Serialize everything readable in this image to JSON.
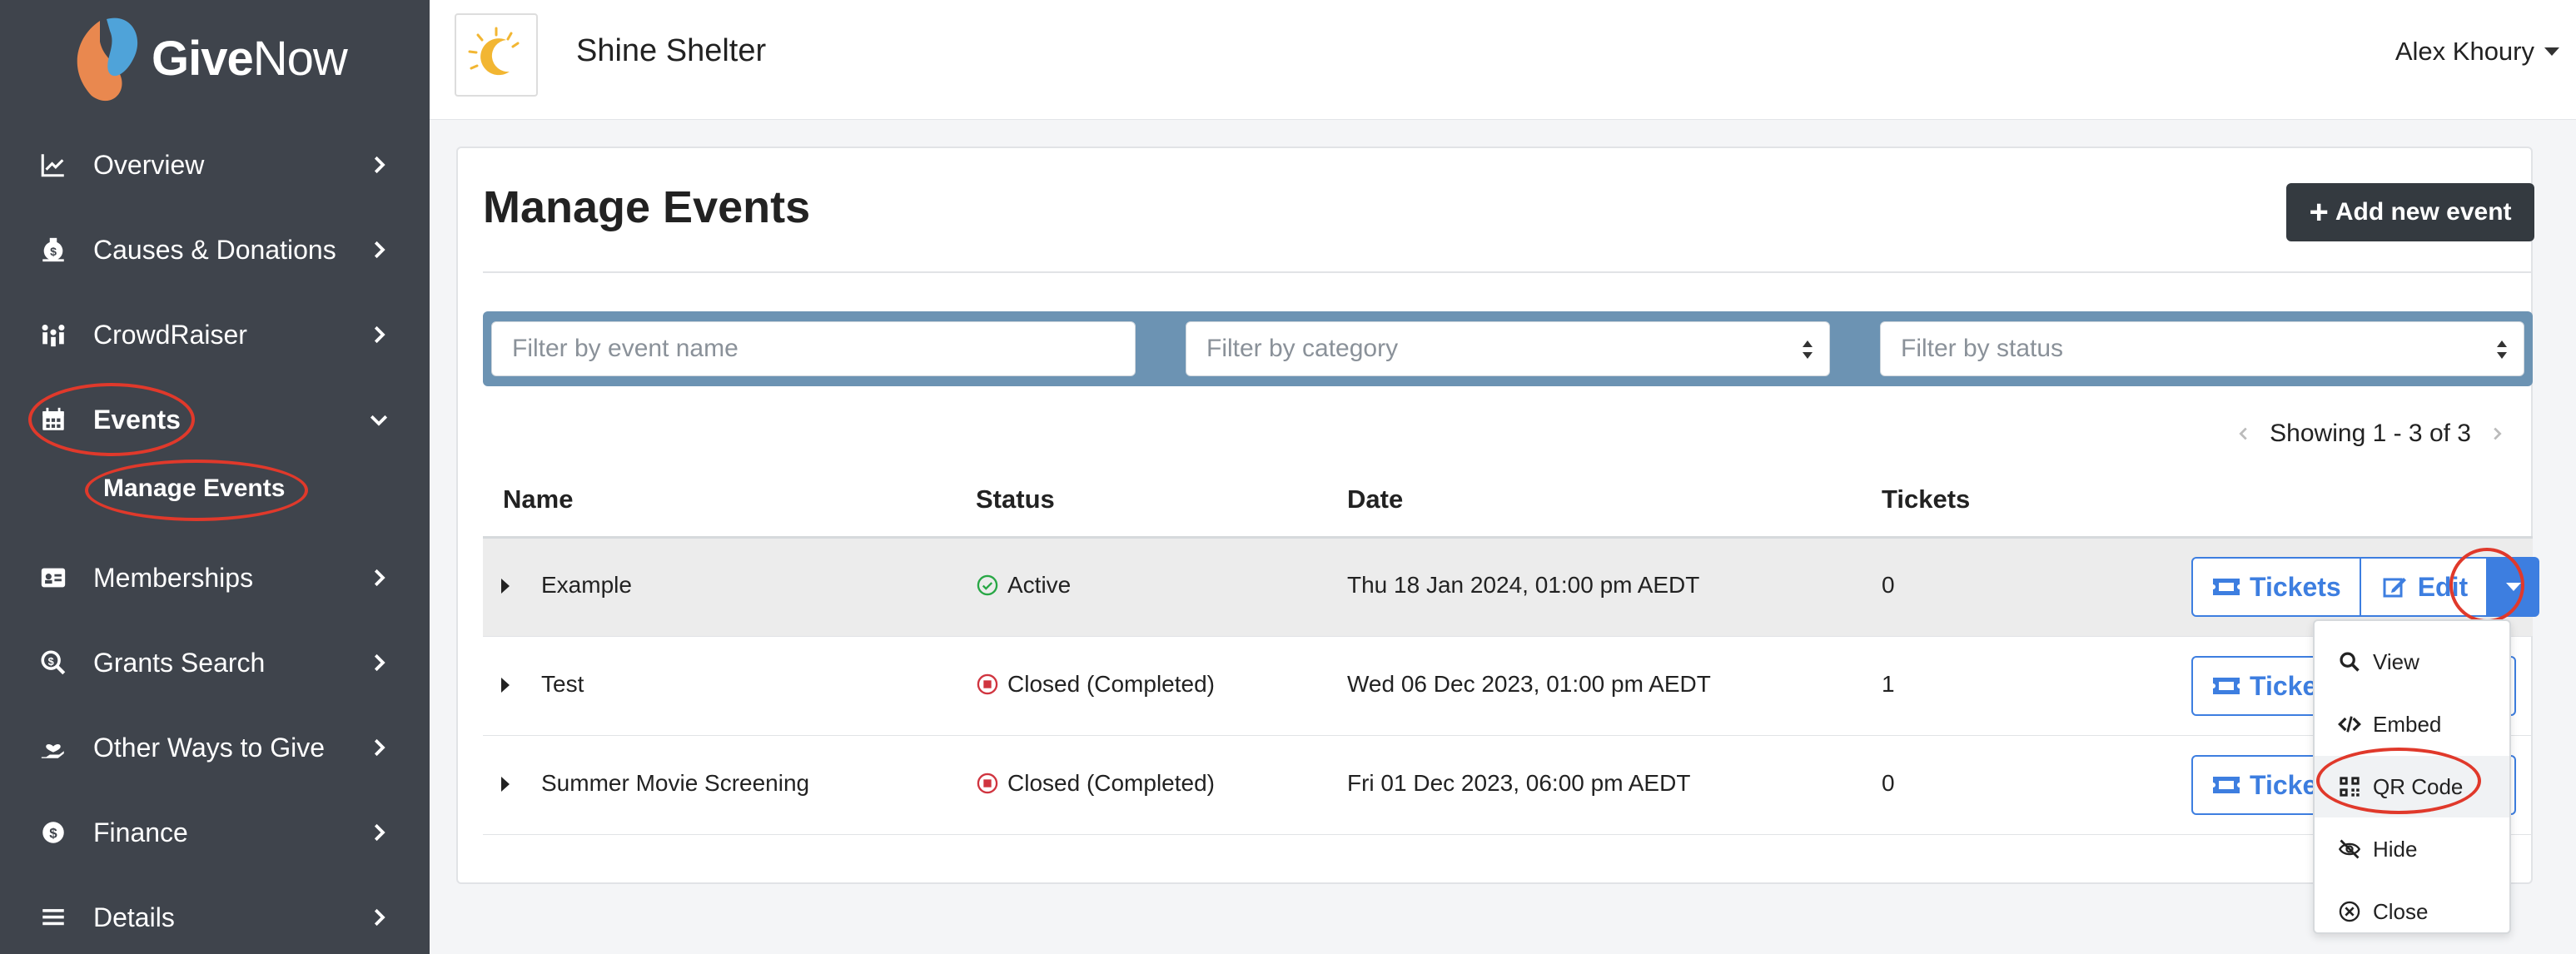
{
  "brand": {
    "logo_bold": "Give",
    "logo_rest": "Now"
  },
  "sidebar": {
    "items": [
      {
        "label": "Overview",
        "icon": "chart-line-icon"
      },
      {
        "label": "Causes & Donations",
        "icon": "money-bag-icon"
      },
      {
        "label": "CrowdRaiser",
        "icon": "people-group-icon"
      },
      {
        "label": "Events",
        "icon": "calendar-icon",
        "expanded": true
      },
      {
        "label": "Memberships",
        "icon": "id-card-icon"
      },
      {
        "label": "Grants Search",
        "icon": "search-dollar-icon"
      },
      {
        "label": "Other Ways to Give",
        "icon": "hand-heart-icon"
      },
      {
        "label": "Finance",
        "icon": "coins-icon"
      },
      {
        "label": "Details",
        "icon": "list-icon"
      }
    ],
    "sub_item": "Manage Events"
  },
  "header": {
    "org_name": "Shine Shelter",
    "user_name": "Alex Khoury"
  },
  "main": {
    "title": "Manage Events",
    "add_button": "Add new event",
    "filters": {
      "name_placeholder": "Filter by event name",
      "category_placeholder": "Filter by category",
      "status_placeholder": "Filter by status"
    },
    "pager": "Showing 1 - 3 of 3",
    "columns": [
      "Name",
      "Status",
      "Date",
      "Tickets"
    ],
    "rows": [
      {
        "name": "Example",
        "status": "Active",
        "status_type": "active",
        "date": "Thu 18 Jan 2024, 01:00 pm AEDT",
        "tickets": "0"
      },
      {
        "name": "Test",
        "status": "Closed (Completed)",
        "status_type": "closed",
        "date": "Wed 06 Dec 2023, 01:00 pm AEDT",
        "tickets": "1"
      },
      {
        "name": "Summer Movie Screening",
        "status": "Closed (Completed)",
        "status_type": "closed",
        "date": "Fri 01 Dec 2023, 06:00 pm AEDT",
        "tickets": "0"
      }
    ],
    "row_actions": {
      "tickets_label": "Tickets",
      "tickets_truncated": "Ticket",
      "edit_label": "Edit"
    }
  },
  "dropdown_menu": {
    "items": [
      {
        "label": "View",
        "icon": "search-icon"
      },
      {
        "label": "Embed",
        "icon": "code-icon"
      },
      {
        "label": "QR Code",
        "icon": "qr-code-icon"
      },
      {
        "label": "Hide",
        "icon": "eye-slash-icon"
      },
      {
        "label": "Close",
        "icon": "close-circle-icon"
      }
    ]
  },
  "colors": {
    "sidebar_bg": "#3f444c",
    "accent_blue": "#3d7ee0",
    "filter_bar": "#6c93b3",
    "annotation_red": "#e0392b",
    "active_green": "#28a745",
    "closed_red": "#d0343f"
  }
}
